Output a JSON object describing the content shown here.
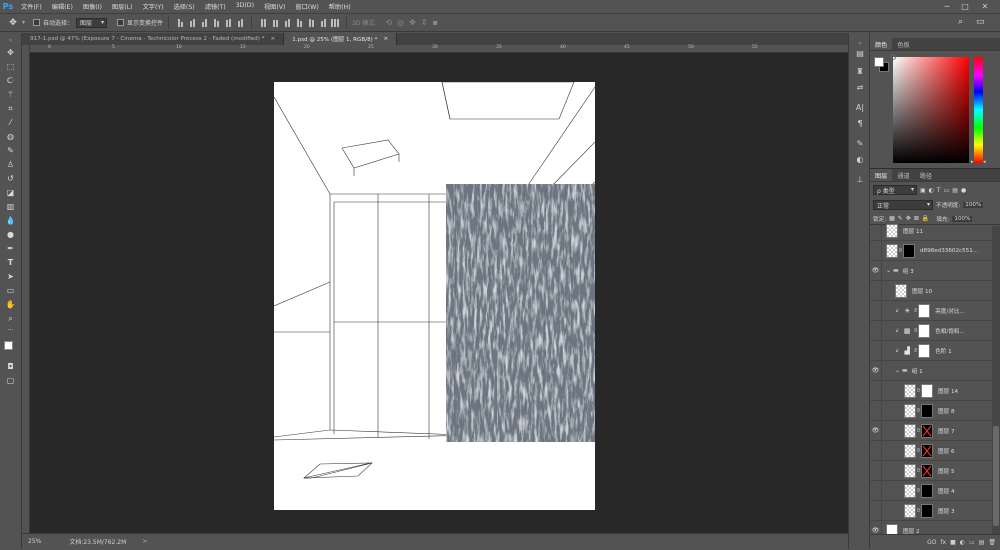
{
  "app": {
    "logo": "Ps"
  },
  "menu": [
    "文件(F)",
    "编辑(E)",
    "图像(I)",
    "图层(L)",
    "文字(Y)",
    "选择(S)",
    "滤镜(T)",
    "3D(D)",
    "视图(V)",
    "窗口(W)",
    "帮助(H)"
  ],
  "options": {
    "auto_select_label": "自动选择：",
    "auto_select_value": "图层",
    "show_transform_label": "显示变换控件",
    "mode_3d_label": "3D 模式："
  },
  "tabs": [
    {
      "label": "917-1.psd @ 47% (Exposure 7 - Cinema - Technicolor Process 2 - Faded (modified) *",
      "active": false
    },
    {
      "label": "1.psd @ 25% (图层 1, RGB/8) *",
      "active": true
    }
  ],
  "ruler_marks": [
    "0",
    "5",
    "10",
    "15",
    "20",
    "25",
    "30",
    "35",
    "40",
    "45",
    "50",
    "55"
  ],
  "status": {
    "zoom": "25%",
    "doc_size": "文档:23.5M/762.2M"
  },
  "color_panel": {
    "tabs": [
      "颜色",
      "色板"
    ],
    "foreground": "#ffffff",
    "background": "#000000"
  },
  "layers_panel": {
    "tabs": [
      "图层",
      "通道",
      "路径"
    ],
    "filter_label": "ρ 类型",
    "blend_mode": "正常",
    "opacity_label": "不透明度:",
    "opacity_value": "100%",
    "lock_label": "锁定:",
    "fill_label": "填充:",
    "fill_value": "100%",
    "layers": [
      {
        "name": "图层 11",
        "visible": false,
        "indent": 0,
        "kind": "pixel",
        "mask": null
      },
      {
        "name": "d898ed33602c551...",
        "visible": false,
        "indent": 0,
        "kind": "pixel",
        "mask": "black"
      },
      {
        "name": "组 3",
        "visible": true,
        "indent": 0,
        "kind": "group",
        "mask": null
      },
      {
        "name": "图层 10",
        "visible": false,
        "indent": 1,
        "kind": "pixel",
        "mask": null
      },
      {
        "name": "亮度/对比...",
        "visible": false,
        "indent": 1,
        "kind": "adjust",
        "mask": "white",
        "icon": "☀"
      },
      {
        "name": "色相/饱和...",
        "visible": false,
        "indent": 1,
        "kind": "adjust",
        "mask": "white",
        "icon": "▦"
      },
      {
        "name": "色阶 1",
        "visible": false,
        "indent": 1,
        "kind": "adjust",
        "mask": "white",
        "icon": "▟"
      },
      {
        "name": "组 1",
        "visible": true,
        "indent": 1,
        "kind": "group",
        "mask": null
      },
      {
        "name": "图层 14",
        "visible": false,
        "indent": 2,
        "kind": "pixel",
        "mask": "white"
      },
      {
        "name": "图层 8",
        "visible": false,
        "indent": 2,
        "kind": "pixel",
        "mask": "black"
      },
      {
        "name": "图层 7",
        "visible": true,
        "indent": 2,
        "kind": "pixel",
        "mask": "red-x"
      },
      {
        "name": "图层 6",
        "visible": false,
        "indent": 2,
        "kind": "pixel",
        "mask": "red-x"
      },
      {
        "name": "图层 5",
        "visible": false,
        "indent": 2,
        "kind": "pixel",
        "mask": "red-x"
      },
      {
        "name": "图层 4",
        "visible": false,
        "indent": 2,
        "kind": "pixel",
        "mask": "black"
      },
      {
        "name": "图层 3",
        "visible": false,
        "indent": 2,
        "kind": "pixel",
        "mask": "black"
      },
      {
        "name": "图层 2",
        "visible": true,
        "indent": 0,
        "kind": "white",
        "mask": null
      }
    ],
    "footer_icons": [
      "GO",
      "fx",
      "■",
      "◐",
      "▭",
      "▤",
      "🗑"
    ]
  }
}
